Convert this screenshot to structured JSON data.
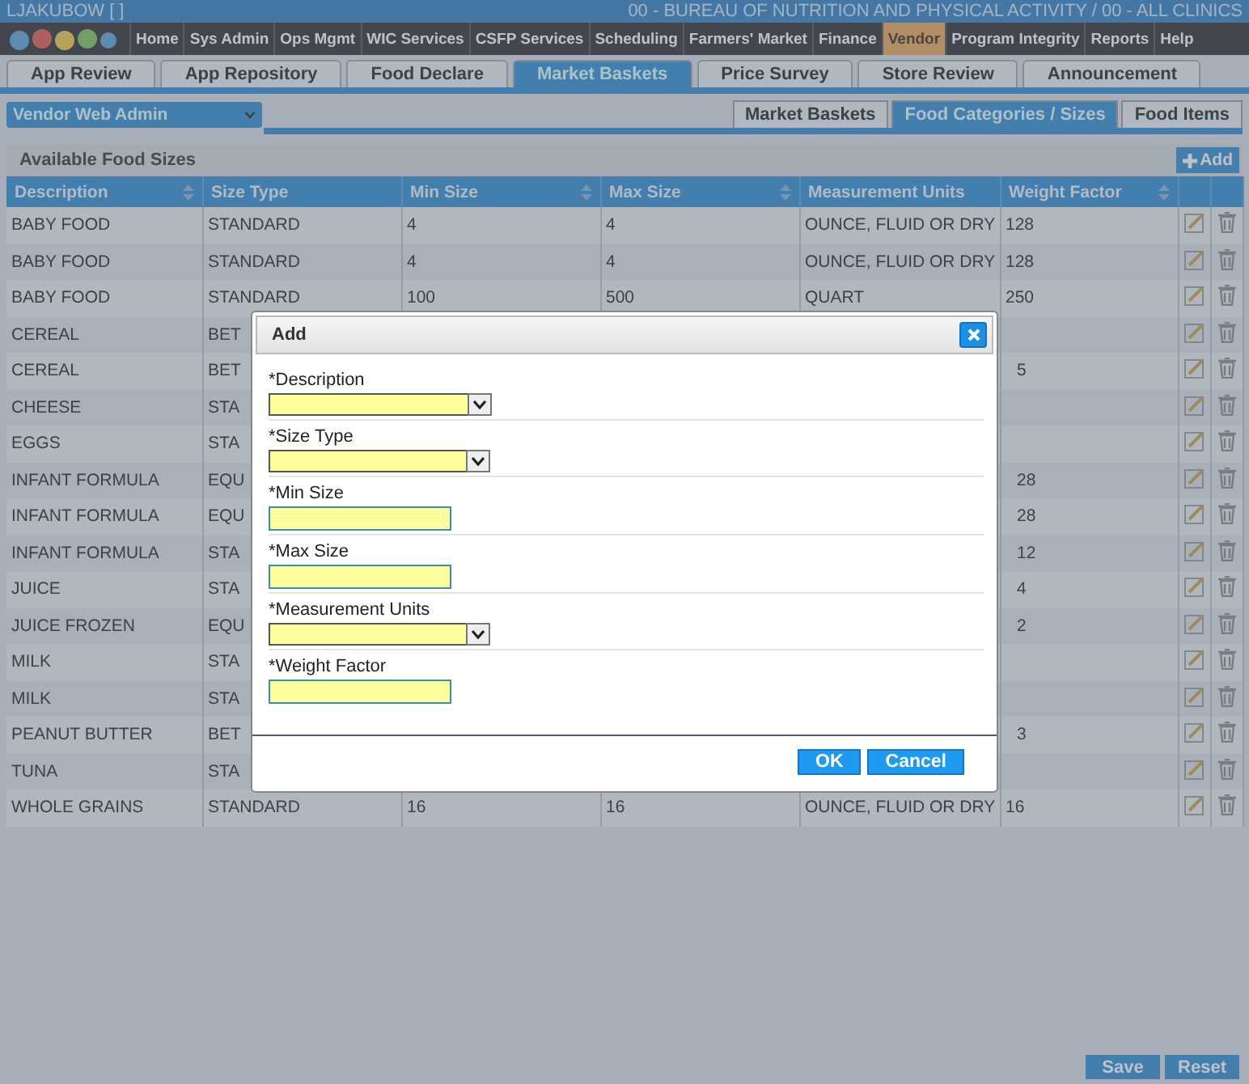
{
  "header": {
    "user": "LJAKUBOW [          ]",
    "agency": "00 - BUREAU OF NUTRITION AND PHYSICAL ACTIVITY / 00 - ALL CLINICS"
  },
  "menu": [
    {
      "label": "Home",
      "selected": false
    },
    {
      "label": "Sys Admin",
      "selected": false
    },
    {
      "label": "Ops Mgmt",
      "selected": false
    },
    {
      "label": "WIC Services",
      "selected": false
    },
    {
      "label": "CSFP Services",
      "selected": false
    },
    {
      "label": "Scheduling",
      "selected": false
    },
    {
      "label": "Farmers' Market",
      "selected": false
    },
    {
      "label": "Finance",
      "selected": false
    },
    {
      "label": "Vendor",
      "selected": true
    },
    {
      "label": "Program Integrity",
      "selected": false
    },
    {
      "label": "Reports",
      "selected": false
    },
    {
      "label": "Help",
      "selected": false
    }
  ],
  "tabs": [
    {
      "label": "App Review",
      "selected": false
    },
    {
      "label": "App Repository",
      "selected": false
    },
    {
      "label": "Food Declare",
      "selected": false
    },
    {
      "label": "Market Baskets",
      "selected": true
    },
    {
      "label": "Price Survey",
      "selected": false
    },
    {
      "label": "Store Review",
      "selected": false
    },
    {
      "label": "Announcement",
      "selected": false
    }
  ],
  "module_select": {
    "value": "Vendor Web Admin"
  },
  "subtabs": [
    {
      "label": "Market Baskets",
      "selected": false
    },
    {
      "label": "Food Categories / Sizes",
      "selected": true
    },
    {
      "label": "Food Items",
      "selected": false
    }
  ],
  "panel": {
    "title": "Available Food Sizes",
    "add_button": "Add"
  },
  "table": {
    "columns": [
      {
        "label": "Description",
        "sortable": true
      },
      {
        "label": "Size Type",
        "sortable": false
      },
      {
        "label": "Min Size",
        "sortable": true
      },
      {
        "label": "Max Size",
        "sortable": true
      },
      {
        "label": "Measurement Units",
        "sortable": false
      },
      {
        "label": "Weight Factor",
        "sortable": true
      }
    ],
    "rows": [
      {
        "cells": [
          "BABY FOOD",
          "STANDARD",
          "4",
          "4",
          "OUNCE, FLUID OR DRY",
          "128"
        ]
      },
      {
        "cells": [
          "BABY FOOD",
          "STANDARD",
          "4",
          "4",
          "OUNCE, FLUID OR DRY",
          "128"
        ]
      },
      {
        "cells": [
          "BABY FOOD",
          "STANDARD",
          "100",
          "500",
          "QUART",
          "250"
        ]
      },
      {
        "cells": [
          "CEREAL",
          "BET"
        ]
      },
      {
        "cells": [
          "CEREAL",
          "BET",
          "",
          "",
          "",
          "5"
        ]
      },
      {
        "cells": [
          "CHEESE",
          "STA"
        ]
      },
      {
        "cells": [
          "EGGS",
          "STA"
        ]
      },
      {
        "cells": [
          "INFANT FORMULA",
          "EQU",
          "",
          "",
          "",
          "28"
        ]
      },
      {
        "cells": [
          "INFANT FORMULA",
          "EQU",
          "",
          "",
          "",
          "28"
        ]
      },
      {
        "cells": [
          "INFANT FORMULA",
          "STA",
          "",
          "",
          "",
          "12"
        ]
      },
      {
        "cells": [
          "JUICE",
          "STA",
          "",
          "",
          "",
          "4"
        ]
      },
      {
        "cells": [
          "JUICE FROZEN",
          "EQU",
          "",
          "",
          "",
          "2"
        ]
      },
      {
        "cells": [
          "MILK",
          "STA"
        ]
      },
      {
        "cells": [
          "MILK",
          "STA"
        ]
      },
      {
        "cells": [
          "PEANUT BUTTER",
          "BET",
          "",
          "",
          "",
          "3"
        ]
      },
      {
        "cells": [
          "TUNA",
          "STA"
        ]
      },
      {
        "cells": [
          "WHOLE GRAINS",
          "STANDARD",
          "16",
          "16",
          "OUNCE, FLUID OR DRY",
          "16"
        ]
      }
    ]
  },
  "footer_buttons": [
    "Save",
    "Reset"
  ],
  "dialog": {
    "title": "Add",
    "fields": [
      {
        "label": "*Description",
        "kind": "select"
      },
      {
        "label": "*Size Type",
        "kind": "select"
      },
      {
        "label": "*Min Size",
        "kind": "text"
      },
      {
        "label": "*Max Size",
        "kind": "text"
      },
      {
        "label": "*Measurement Units",
        "kind": "select"
      },
      {
        "label": "*Weight Factor",
        "kind": "text"
      }
    ],
    "buttons": [
      "OK",
      "Cancel"
    ]
  }
}
